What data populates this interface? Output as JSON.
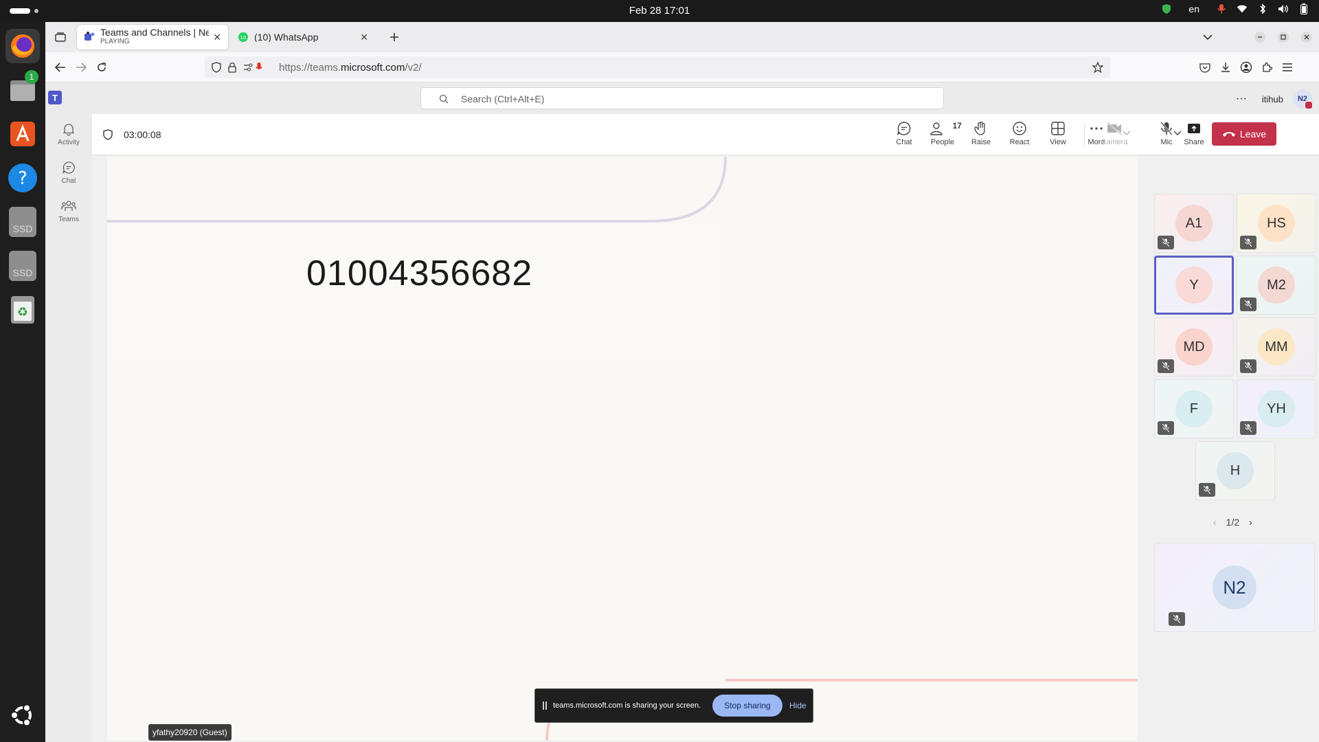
{
  "system": {
    "clock": "Feb 28  17:01",
    "language": "en"
  },
  "dock": {
    "files_badge": "1",
    "ssd_label_1": "SSD",
    "ssd_label_2": "SSD"
  },
  "browser": {
    "tabs": [
      {
        "title": "Teams and Channels | New",
        "subtitle": "PLAYING"
      },
      {
        "title": "(10) WhatsApp",
        "favicon_badge": "10"
      }
    ],
    "url_prefix": "https://teams.",
    "url_domain": "microsoft.com",
    "url_suffix": "/v2/"
  },
  "teams": {
    "search_placeholder": "Search (Ctrl+Alt+E)",
    "org_name": "itihub",
    "user_initials": "N2",
    "rail": [
      {
        "label": "Activity",
        "icon": "bell-icon"
      },
      {
        "label": "Chat",
        "icon": "chat-icon"
      },
      {
        "label": "Teams",
        "icon": "teams-icon"
      }
    ],
    "meeting": {
      "timer": "03:00:08",
      "people_count": "17",
      "toolbar": {
        "chat": "Chat",
        "people": "People",
        "raise": "Raise",
        "react": "React",
        "view": "View",
        "more": "More",
        "camera": "Camera",
        "mic": "Mic",
        "share": "Share",
        "leave": "Leave"
      },
      "shared_content_text": "01004356682",
      "presenter_label": "yfathy20920 (Guest)",
      "sharing_bar": {
        "message": "teams.microsoft.com is sharing your screen.",
        "stop": "Stop sharing",
        "hide": "Hide"
      },
      "participants": [
        {
          "initials": "A1",
          "color": "#f5d6d3"
        },
        {
          "initials": "HS",
          "color": "#fde2c8"
        },
        {
          "initials": "Y",
          "color": "#fadad6"
        },
        {
          "initials": "M2",
          "color": "#f3d8d4"
        },
        {
          "initials": "MD",
          "color": "#fad3cd"
        },
        {
          "initials": "MM",
          "color": "#fbe7c6"
        },
        {
          "initials": "F",
          "color": "#d8eef1"
        },
        {
          "initials": "YH",
          "color": "#d9ecee"
        },
        {
          "initials": "H",
          "color": "#dbe8ee"
        }
      ],
      "pager": "1/2",
      "self_initials": "N2"
    }
  }
}
